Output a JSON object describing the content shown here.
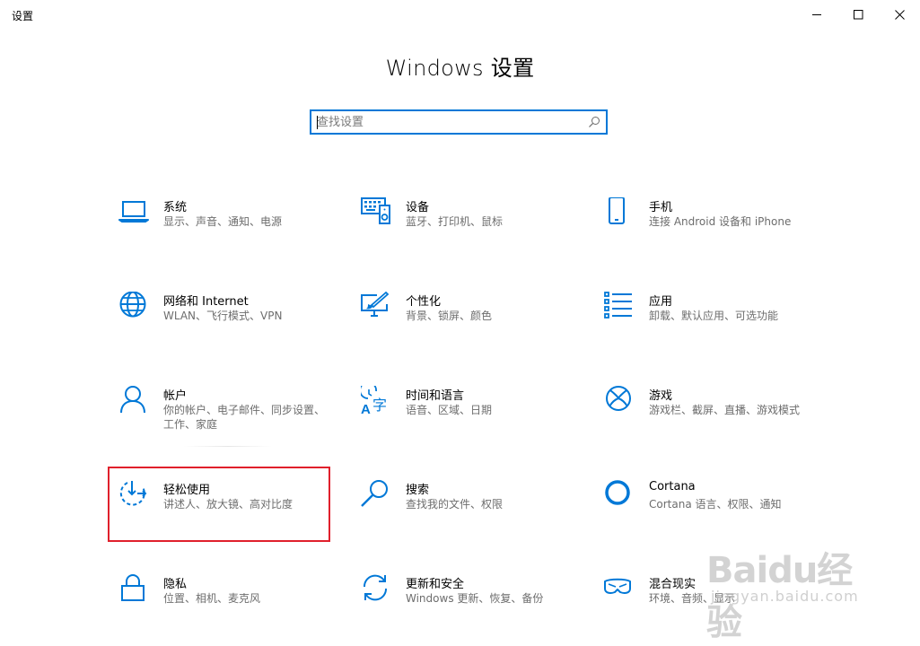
{
  "window": {
    "title": "设置",
    "minimize_icon": "minimize-icon",
    "maximize_icon": "maximize-icon",
    "close_icon": "close-icon"
  },
  "page": {
    "heading": "Windows 设置"
  },
  "search": {
    "placeholder": "查找设置",
    "value": "",
    "icon": "search-icon"
  },
  "accent_color": "#0078d7",
  "highlight_color": "#e0202c",
  "tiles": [
    {
      "label": "系统",
      "desc": "显示、声音、通知、电源",
      "icon": "laptop-icon"
    },
    {
      "label": "设备",
      "desc": "蓝牙、打印机、鼠标",
      "icon": "devices-icon"
    },
    {
      "label": "手机",
      "desc": "连接 Android 设备和 iPhone",
      "icon": "phone-icon"
    },
    {
      "label": "网络和 Internet",
      "desc": "WLAN、飞行模式、VPN",
      "icon": "globe-icon"
    },
    {
      "label": "个性化",
      "desc": "背景、锁屏、颜色",
      "icon": "personalization-icon"
    },
    {
      "label": "应用",
      "desc": "卸载、默认应用、可选功能",
      "icon": "apps-list-icon"
    },
    {
      "label": "帐户",
      "desc": "你的帐户、电子邮件、同步设置、工作、家庭",
      "icon": "person-icon"
    },
    {
      "label": "时间和语言",
      "desc": "语音、区域、日期",
      "icon": "time-language-icon"
    },
    {
      "label": "游戏",
      "desc": "游戏栏、截屏、直播、游戏模式",
      "icon": "xbox-icon"
    },
    {
      "label": "轻松使用",
      "desc": "讲述人、放大镜、高对比度",
      "icon": "ease-of-access-icon"
    },
    {
      "label": "搜索",
      "desc": "查找我的文件、权限",
      "icon": "magnifier-icon"
    },
    {
      "label": "Cortana",
      "desc": "Cortana 语言、权限、通知",
      "icon": "cortana-icon"
    },
    {
      "label": "隐私",
      "desc": "位置、相机、麦克风",
      "icon": "lock-icon"
    },
    {
      "label": "更新和安全",
      "desc": "Windows 更新、恢复、备份",
      "icon": "sync-icon"
    },
    {
      "label": "混合现实",
      "desc": "环境、音频、显示",
      "icon": "headset-icon"
    }
  ],
  "watermark": {
    "text": "Baidu经验",
    "sub": "jingyan.baidu.com"
  }
}
